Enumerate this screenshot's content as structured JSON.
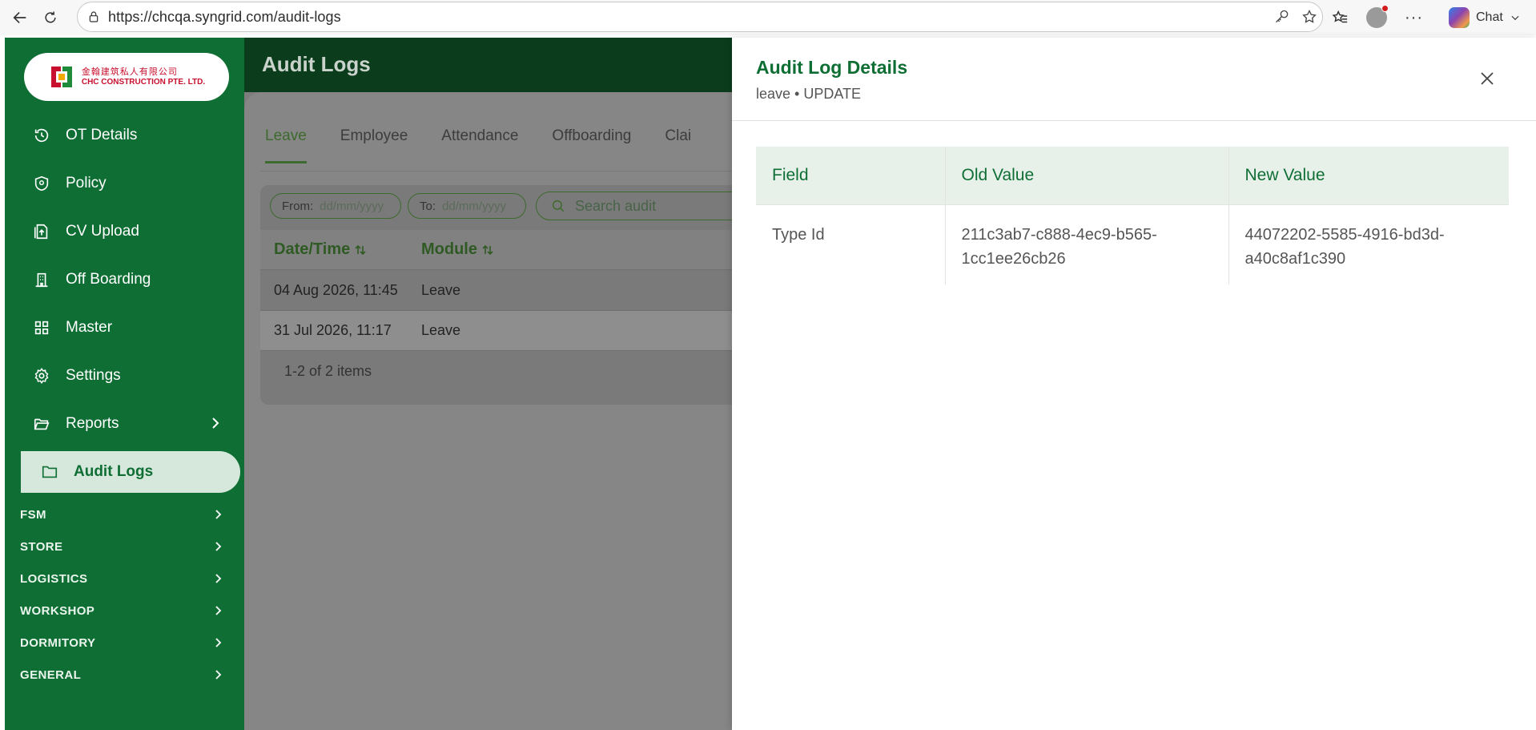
{
  "browser": {
    "url": "https://chcqa.syngrid.com/audit-logs",
    "chat_label": "Chat"
  },
  "sidebar": {
    "logo": {
      "cn": "金翰建筑私人有限公司",
      "en": "CHC CONSTRUCTION PTE. LTD."
    },
    "items": [
      {
        "label": "OT Details",
        "icon": "clock-history-icon"
      },
      {
        "label": "Policy",
        "icon": "shield-icon"
      },
      {
        "label": "CV Upload",
        "icon": "file-upload-icon"
      },
      {
        "label": "Off Boarding",
        "icon": "building-icon"
      },
      {
        "label": "Master",
        "icon": "grid-icon"
      },
      {
        "label": "Settings",
        "icon": "gear-icon"
      },
      {
        "label": "Reports",
        "icon": "folder-open-icon"
      },
      {
        "label": "Audit Logs",
        "icon": "folder-icon"
      }
    ],
    "sections": [
      "FSM",
      "STORE",
      "LOGISTICS",
      "WORKSHOP",
      "DORMITORY",
      "GENERAL"
    ]
  },
  "main": {
    "title": "Audit Logs",
    "tabs": [
      "Leave",
      "Employee",
      "Attendance",
      "Offboarding",
      "Clai"
    ],
    "filters": {
      "from_label": "From:",
      "to_label": "To:",
      "date_placeholder": "dd/mm/yyyy",
      "search_placeholder": "Search audit"
    },
    "columns": [
      "Date/Time",
      "Module"
    ],
    "rows": [
      {
        "datetime": "04 Aug 2026, 11:45",
        "module": "Leave"
      },
      {
        "datetime": "31 Jul 2026, 11:17",
        "module": "Leave"
      }
    ],
    "pager": "1-2 of 2 items"
  },
  "drawer": {
    "title": "Audit Log Details",
    "subtitle": "leave • UPDATE",
    "columns": [
      "Field",
      "Old Value",
      "New Value"
    ],
    "rows": [
      {
        "field": "Type Id",
        "old_line1": "211c3ab7-c888-4ec9-b565-",
        "old_line2": "1cc1ee26cb26",
        "new_line1": "44072202-5585-4916-bd3d-",
        "new_line2": "a40c8af1c390"
      }
    ]
  },
  "colors": {
    "brand_green": "#0f6e34",
    "active_item_bg": "#d6e8dc",
    "header_bg": "#e7f1ea"
  }
}
